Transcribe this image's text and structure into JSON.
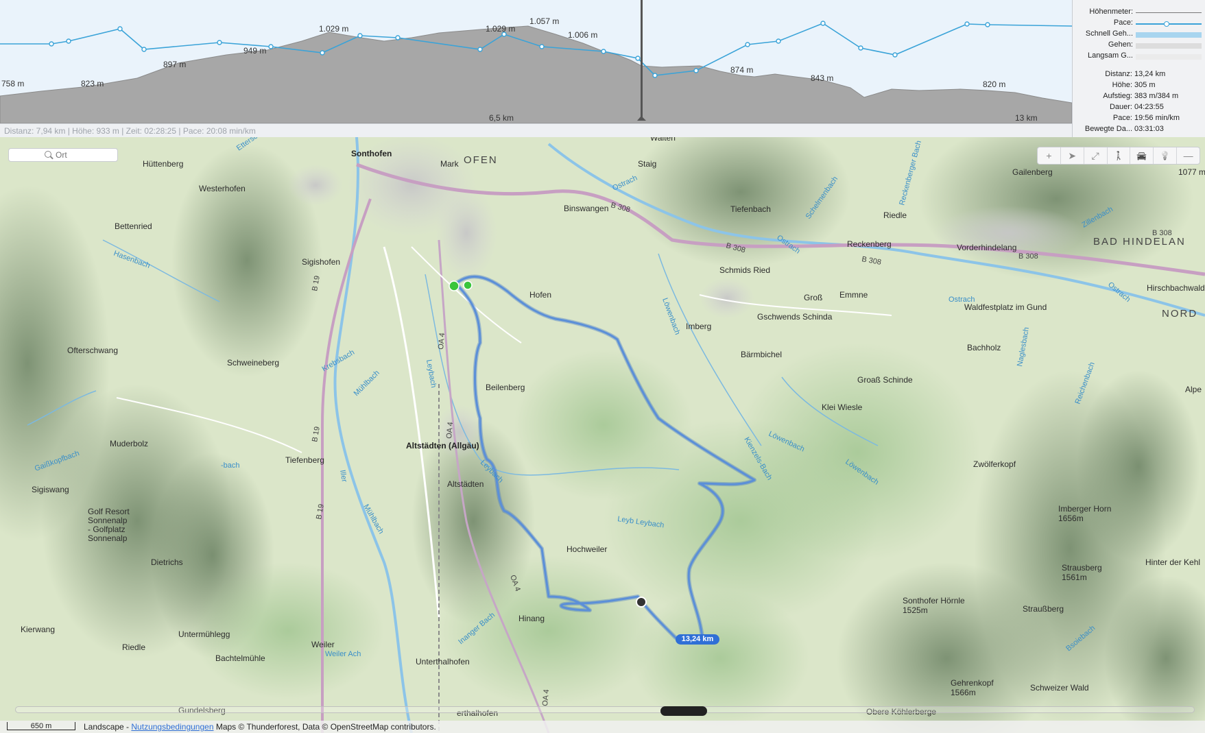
{
  "profile": {
    "elevation_labels": [
      "758 m",
      "823 m",
      "897 m",
      "949 m",
      "1.029 m",
      "1.029 m",
      "1.057 m",
      "1.006 m",
      "874 m",
      "843 m",
      "820 m"
    ],
    "distance_ticks": [
      "6,5 km",
      "13 km"
    ],
    "status": "Distanz: 7,94 km | Höhe: 933 m | Zeit: 02:28:25 | Pace: 20:08 min/km",
    "colors": {
      "elevation_fill": "#a9a9a9",
      "pace_line": "#3aa3d8",
      "cursor": "#555555"
    }
  },
  "legend": {
    "items": [
      {
        "label": "Höhenmeter:",
        "color": "#777777"
      },
      {
        "label": "Pace:",
        "color": "#3aa3d8"
      },
      {
        "label": "Schnell Geh...",
        "color": "#a8d5ef"
      },
      {
        "label": "Gehen:",
        "color": "#dddddd"
      },
      {
        "label": "Langsam G...",
        "color": "#eeeeee"
      }
    ],
    "stats": [
      {
        "label": "Distanz:",
        "value": "13,24 km"
      },
      {
        "label": "Höhe:",
        "value": "305 m"
      },
      {
        "label": "Aufstieg:",
        "value": "383 m/384 m"
      },
      {
        "label": "Dauer:",
        "value": "04:23:55"
      },
      {
        "label": "Pace:",
        "value": "19:56 min/km"
      },
      {
        "label": "Bewegte Da...",
        "value": "03:31:03"
      }
    ]
  },
  "map": {
    "search": {
      "placeholder": "Ort",
      "icon": "search-icon"
    },
    "toolbar": [
      "zoom-in-icon",
      "location-arrow-icon",
      "fullscreen-icon",
      "walking-icon",
      "car-icon",
      "lightbulb-icon",
      "zoom-out-icon"
    ],
    "toolbar_glyphs": [
      "+",
      "➤",
      "⤢",
      "🚶",
      "🚘",
      "💡",
      "—"
    ],
    "track_distance": "13,24 km",
    "track_color": "#5b8fd8",
    "places": {
      "sonthofen": "Sonthofen",
      "ofen": "OFEN",
      "mark": "Mark",
      "walten": "Walten",
      "staig": "Staig",
      "huttenberg": "Hüttenberg",
      "westerhofen": "Westerhofen",
      "binswangen": "Binswangen",
      "tiefenbach_n": "Tiefenbach",
      "riedle_n": "Riedle",
      "gailenberg": "Gailenberg",
      "elev_1077": "1077 m",
      "bettenried": "Bettenried",
      "sigishofen": "Sigishofen",
      "reckenberg": "Reckenberg",
      "vorderhindelang": "Vorderhindelang",
      "bad_hindelang": "BAD HINDELAN",
      "schmids_ried": "Schmids Ried",
      "hofen": "Hofen",
      "gross": "Groß",
      "emmne": "Emmne",
      "waldfestplatz": "Waldfestplatz im Gund",
      "hirschbachwald": "Hirschbachwald",
      "nord": "NORD",
      "imberg": "Imberg",
      "gschwends_schinda": "Gschwends Schinda",
      "ofterschwang": "Ofterschwang",
      "schweineberg": "Schweineberg",
      "bachholz": "Bachholz",
      "barmbichel": "Bärmbichel",
      "gross_schinde": "Groaß Schinde",
      "beilenberg": "Beilenberg",
      "klei_wiesle": "Klei Wiesle",
      "alpe": "Alpe",
      "muderbolz": "Muderbolz",
      "altstadten_allgau": "Altstädten (Allgäu)",
      "tiefenberg": "Tiefenberg",
      "altstadten": "Altstädten",
      "zwolferkopf": "Zwölferkopf",
      "sigiswang": "Sigiswang",
      "golf1": "Golf Resort",
      "golf2": "Sonnenalp",
      "golf3": "- Golfplatz",
      "golf4": "Sonnenalp",
      "imberger_horn": "Imberger Horn",
      "imberger_horn_elev": "1656m",
      "hochweiler": "Hochweiler",
      "dietrichs": "Dietrichs",
      "hinter_der_kehl": "Hinter der Kehl",
      "strausberg": "Strausberg",
      "strausberg_elev": "1561m",
      "sonthofer_hornle": "Sonthofer Hörnle",
      "sonthofer_hornle_elev": "1525m",
      "straussberg": "Straußberg",
      "kierwang": "Kierwang",
      "untermuhlegg": "Untermühlegg",
      "hinang": "Hinang",
      "riedle_s": "Riedle",
      "weiler": "Weiler",
      "bachtelmuhle": "Bachtelmühle",
      "unterthalhofen": "Unterthalhofen",
      "gundelsberg": "Gundelsberg",
      "gehrenkopf": "Gehrenkopf",
      "gehrenkopf_elev": "1566m",
      "schweizer_wald": "Schweizer Wald",
      "oberthalhofen": "erthalhofen",
      "obere_kohlerberge": "Obere Köhlerberge"
    },
    "waters": {
      "etterschwang": "Ettersch",
      "ostrach1": "Ostrach",
      "ostrach2": "Ostrach",
      "ostrach3": "Ostrach",
      "ostrach4": "Ostrach",
      "hasenbach": "Hasenbach",
      "krebsbach": "Krebsbach",
      "muhlbach1": "Mühlbach",
      "muhlbach2": "Mühlbach",
      "leybach1": "Leybach",
      "leybach2": "Leybach",
      "leyb_leybach": "Leyb   Leybach",
      "lowenbach1": "Löwenbach",
      "lowenbach2": "Löwenbach",
      "lowenbach3": "Löwenbach",
      "kienzels_bach": "Kienzels-Bach",
      "naglesbach": "Naglesbach",
      "reichenbach": "Reichenbach",
      "gaisskopfbach": "Gaißkopfbach",
      "iller": "Iller",
      "weiler_ach": "Weiler Ach",
      "inanger_bach": "Inanger Bach",
      "schelmenbach": "Schelmenbach",
      "reckenberger_bach": "Reckenberger Bach",
      "zillenbach": "Zillenbach",
      "bsoiebach": "Bsoiebach",
      "bach_w": "-bach"
    },
    "roads": {
      "b308_1": "B 308",
      "b308_2": "B 308",
      "b308_3": "B 308",
      "b308_4": "B 308",
      "b19_1": "B 19",
      "b19_2": "B 19",
      "b19_3": "B 19",
      "oa4_1": "OA 4",
      "oa4_2": "OA 4",
      "oa4_3": "OA 4",
      "oa4_4": "OA 4"
    }
  },
  "footer": {
    "scale": "650 m",
    "layer": "Landscape",
    "sep": " - ",
    "terms_link": "Nutzungsbedingungen",
    "credits": " Maps © Thunderforest, Data © OpenStreetMap contributors."
  }
}
